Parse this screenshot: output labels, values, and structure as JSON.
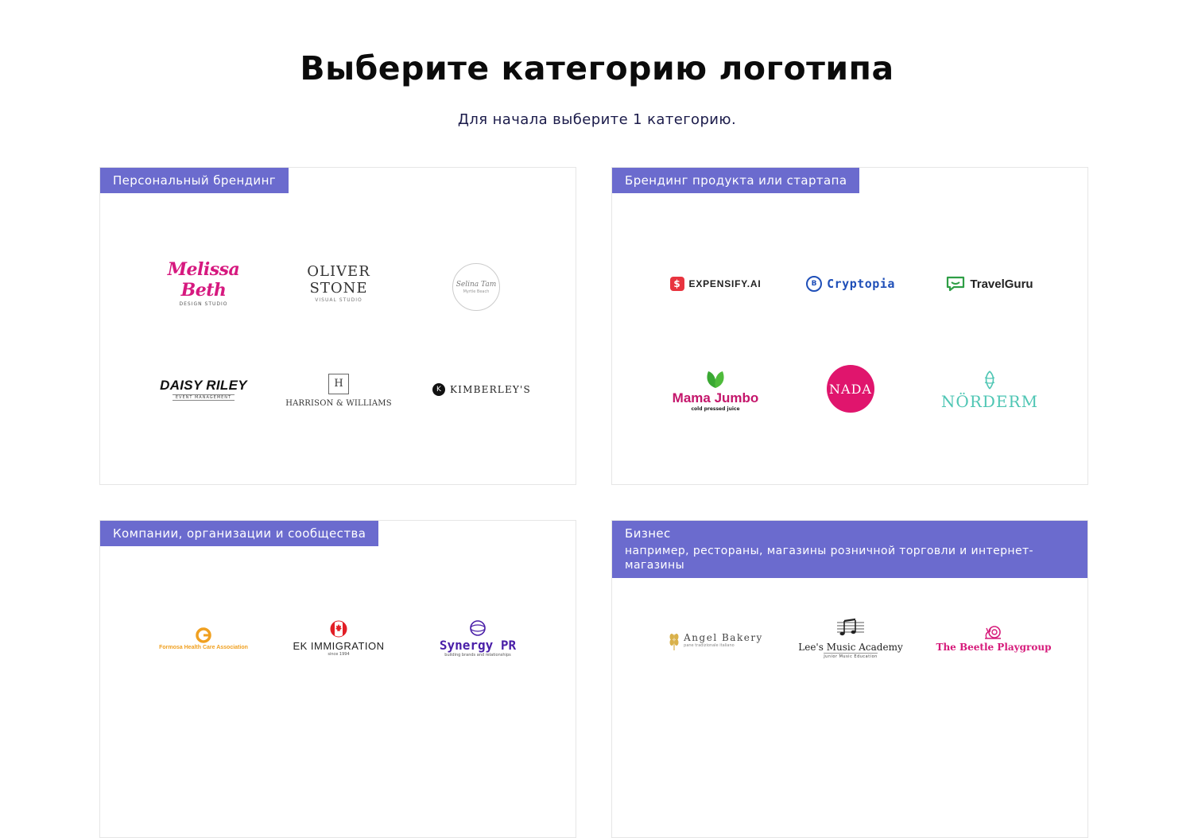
{
  "header": {
    "title": "Выберите категорию логотипа",
    "subtitle": "Для начала выберите 1 категорию."
  },
  "categories": [
    {
      "label": "Персональный брендинг",
      "logos": [
        {
          "name": "Melissa Beth",
          "tagline": "DESIGN STUDIO"
        },
        {
          "name": "OLIVER STONE",
          "tagline": "VISUAL STUDIO"
        },
        {
          "name": "Selina Tam",
          "tagline": "Myrtle Beach"
        },
        {
          "name": "DAISY RILEY",
          "tagline": "EVENT MANAGEMENT"
        },
        {
          "name": "HARRISON & WILLIAMS",
          "tagline": "",
          "monogram": "H"
        },
        {
          "name": "KIMBERLEY'S",
          "tagline": "",
          "monogram": "K"
        }
      ]
    },
    {
      "label": "Брендинг продукта или стартапа",
      "logos": [
        {
          "name": "EXPENSIFY.AI"
        },
        {
          "name": "Cryptopia"
        },
        {
          "name": "TravelGuru"
        },
        {
          "name": "Mama Jumbo",
          "tagline": "cold pressed juice"
        },
        {
          "name": "NADA"
        },
        {
          "name": "NÖRDERM"
        }
      ]
    },
    {
      "label": "Компании, организации и сообщества",
      "logos": [
        {
          "name": "Formosa Health Care Association"
        },
        {
          "name": "EK IMMIGRATION",
          "tagline": "since 1994"
        },
        {
          "name": "Synergy PR",
          "tagline": "building brands and relationships"
        }
      ]
    },
    {
      "label": "Бизнес",
      "sublabel": "например, рестораны, магазины розничной торговли и интернет-магазины",
      "logos": [
        {
          "name": "Angel Bakery",
          "tagline": "pane tradizionale italiano"
        },
        {
          "name": "Lee's Music Academy",
          "tagline": "Junior Music Education"
        },
        {
          "name": "The Beetle Playgroup"
        }
      ]
    }
  ],
  "colors": {
    "accent": "#6b6bce",
    "melissa": "#d6197f",
    "cryptopia": "#1f4fb8",
    "expensify": "#e8343f",
    "travelguru": "#2e9e45",
    "mama_leaf": "#3aa833",
    "mama_text": "#c4166b",
    "nada": "#e0156d",
    "norderm": "#4fc6b4",
    "formosa": "#f0a020",
    "synergy": "#4a1fa8",
    "beetle": "#d61a7a",
    "angel": "#d9b14a"
  },
  "icons": {
    "expensify": "dollar-badge-icon",
    "cryptopia": "coin-icon",
    "travelguru": "chat-smile-icon",
    "mama_jumbo": "leaf-icon",
    "norderm": "leaf-wave-icon",
    "formosa": "swirl-icon",
    "ek": "maple-leaf-flag-icon",
    "synergy": "circle-ring-icon",
    "angel": "wheat-icon",
    "lees": "music-notes-icon",
    "beetle": "snail-icon"
  }
}
